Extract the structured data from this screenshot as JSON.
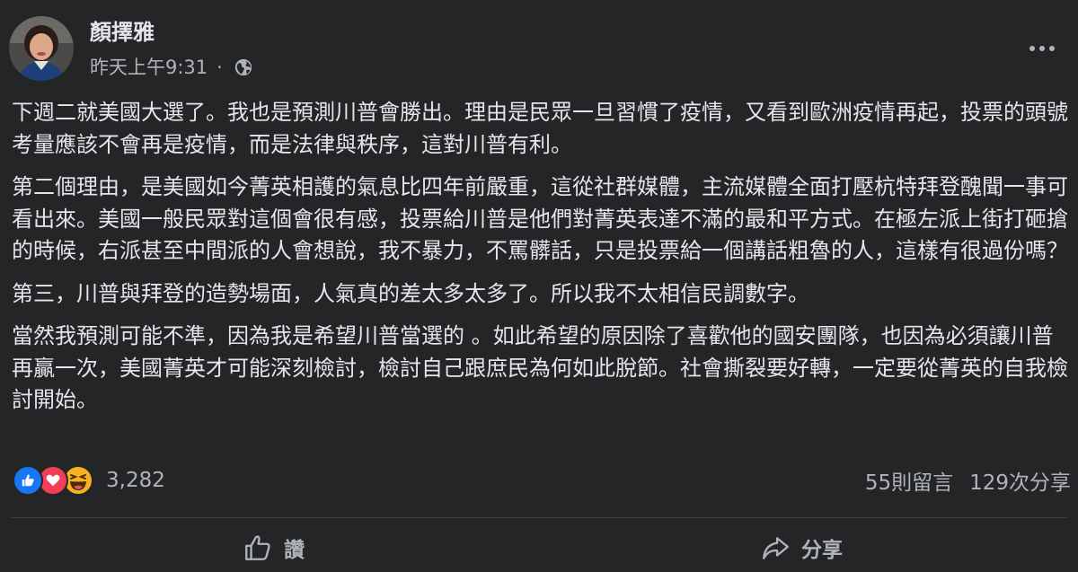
{
  "post": {
    "author": "顏擇雅",
    "timestamp": "昨天上午9:31",
    "separator": "·",
    "audience_icon": "globe-icon",
    "paragraphs": [
      "下週二就美國大選了。我也是預測川普會勝出。理由是民眾一旦習慣了疫情，又看到歐洲疫情再起，投票的頭號考量應該不會再是疫情，而是法律與秩序，這對川普有利。",
      "第二個理由，是美國如今菁英相護的氣息比四年前嚴重，這從社群媒體，主流媒體全面打壓杭特拜登醜聞一事可看出來。美國一般民眾對這個會很有感，投票給川普是他們對菁英表達不滿的最和平方式。在極左派上街打砸搶的時候，右派甚至中間派的人會想說，我不暴力，不罵髒話，只是投票給一個講話粗魯的人，這樣有很過份嗎？",
      "第三，川普與拜登的造勢場面，人氣真的差太多太多了。所以我不太相信民調數字。",
      "當然我預測可能不準，因為我是希望川普當選的 。如此希望的原因除了喜歡他的國安團隊，也因為必須讓川普再贏一次，美國菁英才可能深刻檢討，檢討自己跟庶民為何如此脫節。社會撕裂要好轉，一定要從菁英的自我檢討開始。"
    ]
  },
  "reactions": {
    "icons": [
      "like-reaction-icon",
      "love-reaction-icon",
      "haha-reaction-icon"
    ],
    "count": "3,282"
  },
  "stats": {
    "comments": "55則留言",
    "shares": "129次分享"
  },
  "actions": {
    "like_label": "讚",
    "share_label": "分享"
  },
  "colors": {
    "background": "#242526",
    "text_primary": "#e4e6eb",
    "text_secondary": "#b0b3b8",
    "like_blue": "#1877f2",
    "love_red": "#f33e58",
    "haha_yellow": "#f7b125"
  }
}
